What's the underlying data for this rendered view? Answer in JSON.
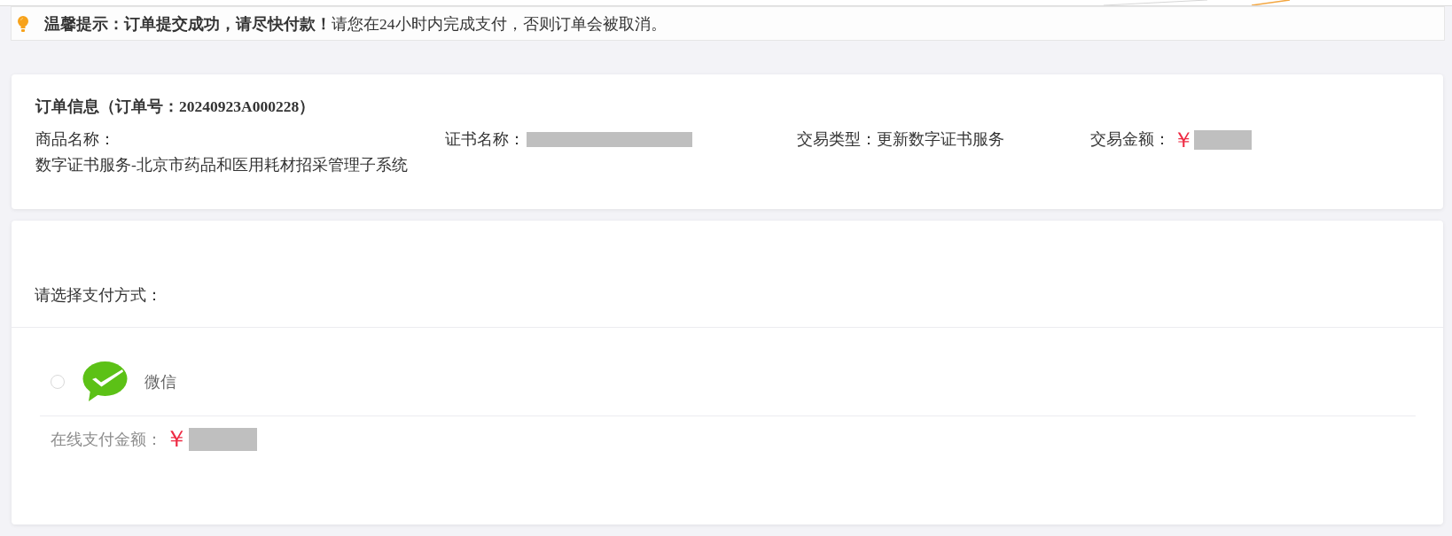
{
  "notice": {
    "text": "**温馨提示：订单提交成功，请尽快付款！**请您在24小时内完成支付，否则订单会被取消。"
  },
  "order_info": {
    "title": "订单信息（订单号：20240923A000228）",
    "fields": [
      {
        "label": "商品名称：",
        "value": "数字证书服务-北京市药品和医用耗材招采管理子系统",
        "redacted": false
      },
      {
        "label": "证书名称：",
        "redacted": true
      },
      {
        "label": "交易类型：",
        "value": "更新数字证书服务",
        "redacted": false
      },
      {
        "label": "交易金额：",
        "currency": "￥",
        "redacted": true
      }
    ]
  },
  "payment": {
    "prompt": "请选择支付方式：",
    "methods": [
      {
        "kind": "wechat",
        "name": "微信",
        "selected": false
      }
    ],
    "amount": {
      "label": "在线支付金额：",
      "currency": "￥",
      "redacted": true
    }
  }
}
